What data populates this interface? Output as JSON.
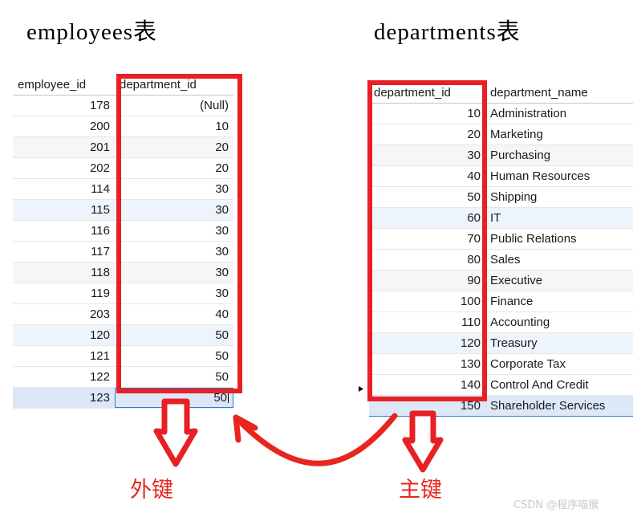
{
  "titles": {
    "employees": "employees表",
    "departments": "departments表"
  },
  "employees_table": {
    "columns": [
      "employee_id",
      "department_id"
    ],
    "rows": [
      {
        "employee_id": "178",
        "department_id": "(Null)",
        "null": true,
        "tint": "r-white"
      },
      {
        "employee_id": "200",
        "department_id": "10",
        "null": false,
        "tint": "r-white"
      },
      {
        "employee_id": "201",
        "department_id": "20",
        "null": false,
        "tint": "r-gray"
      },
      {
        "employee_id": "202",
        "department_id": "20",
        "null": false,
        "tint": "r-white"
      },
      {
        "employee_id": "114",
        "department_id": "30",
        "null": false,
        "tint": "r-white"
      },
      {
        "employee_id": "115",
        "department_id": "30",
        "null": false,
        "tint": "r-blue"
      },
      {
        "employee_id": "116",
        "department_id": "30",
        "null": false,
        "tint": "r-white"
      },
      {
        "employee_id": "117",
        "department_id": "30",
        "null": false,
        "tint": "r-white"
      },
      {
        "employee_id": "118",
        "department_id": "30",
        "null": false,
        "tint": "r-gray"
      },
      {
        "employee_id": "119",
        "department_id": "30",
        "null": false,
        "tint": "r-white"
      },
      {
        "employee_id": "203",
        "department_id": "40",
        "null": false,
        "tint": "r-white"
      },
      {
        "employee_id": "120",
        "department_id": "50",
        "null": false,
        "tint": "r-blue"
      },
      {
        "employee_id": "121",
        "department_id": "50",
        "null": false,
        "tint": "r-white"
      },
      {
        "employee_id": "122",
        "department_id": "50",
        "null": false,
        "tint": "r-white"
      },
      {
        "employee_id": "123",
        "department_id": "50",
        "null": false,
        "tint": "r-sel",
        "focused": true
      }
    ]
  },
  "departments_table": {
    "columns": [
      "department_id",
      "department_name"
    ],
    "rows": [
      {
        "department_id": "10",
        "department_name": "Administration",
        "tint": "r-white"
      },
      {
        "department_id": "20",
        "department_name": "Marketing",
        "tint": "r-white"
      },
      {
        "department_id": "30",
        "department_name": "Purchasing",
        "tint": "r-gray"
      },
      {
        "department_id": "40",
        "department_name": "Human Resources",
        "tint": "r-white"
      },
      {
        "department_id": "50",
        "department_name": "Shipping",
        "tint": "r-white"
      },
      {
        "department_id": "60",
        "department_name": "IT",
        "tint": "r-blue"
      },
      {
        "department_id": "70",
        "department_name": "Public Relations",
        "tint": "r-white"
      },
      {
        "department_id": "80",
        "department_name": "Sales",
        "tint": "r-white"
      },
      {
        "department_id": "90",
        "department_name": "Executive",
        "tint": "r-gray"
      },
      {
        "department_id": "100",
        "department_name": "Finance",
        "tint": "r-white"
      },
      {
        "department_id": "110",
        "department_name": "Accounting",
        "tint": "r-white"
      },
      {
        "department_id": "120",
        "department_name": "Treasury",
        "tint": "r-blue"
      },
      {
        "department_id": "130",
        "department_name": "Corporate Tax",
        "tint": "r-white"
      },
      {
        "department_id": "140",
        "department_name": "Control And Credit",
        "tint": "r-white"
      },
      {
        "department_id": "150",
        "department_name": "Shareholder Services",
        "tint": "r-sel",
        "selected": true
      }
    ]
  },
  "annotations": {
    "foreign_key_label": "外键",
    "primary_key_label": "主键",
    "highlight_color": "#e81f24",
    "annotation_color": "#e8251f",
    "header_highlight_color": "#dbe8f5",
    "selection_border_color": "#2f79c4"
  },
  "watermark": "CSDN @程序喵猴"
}
